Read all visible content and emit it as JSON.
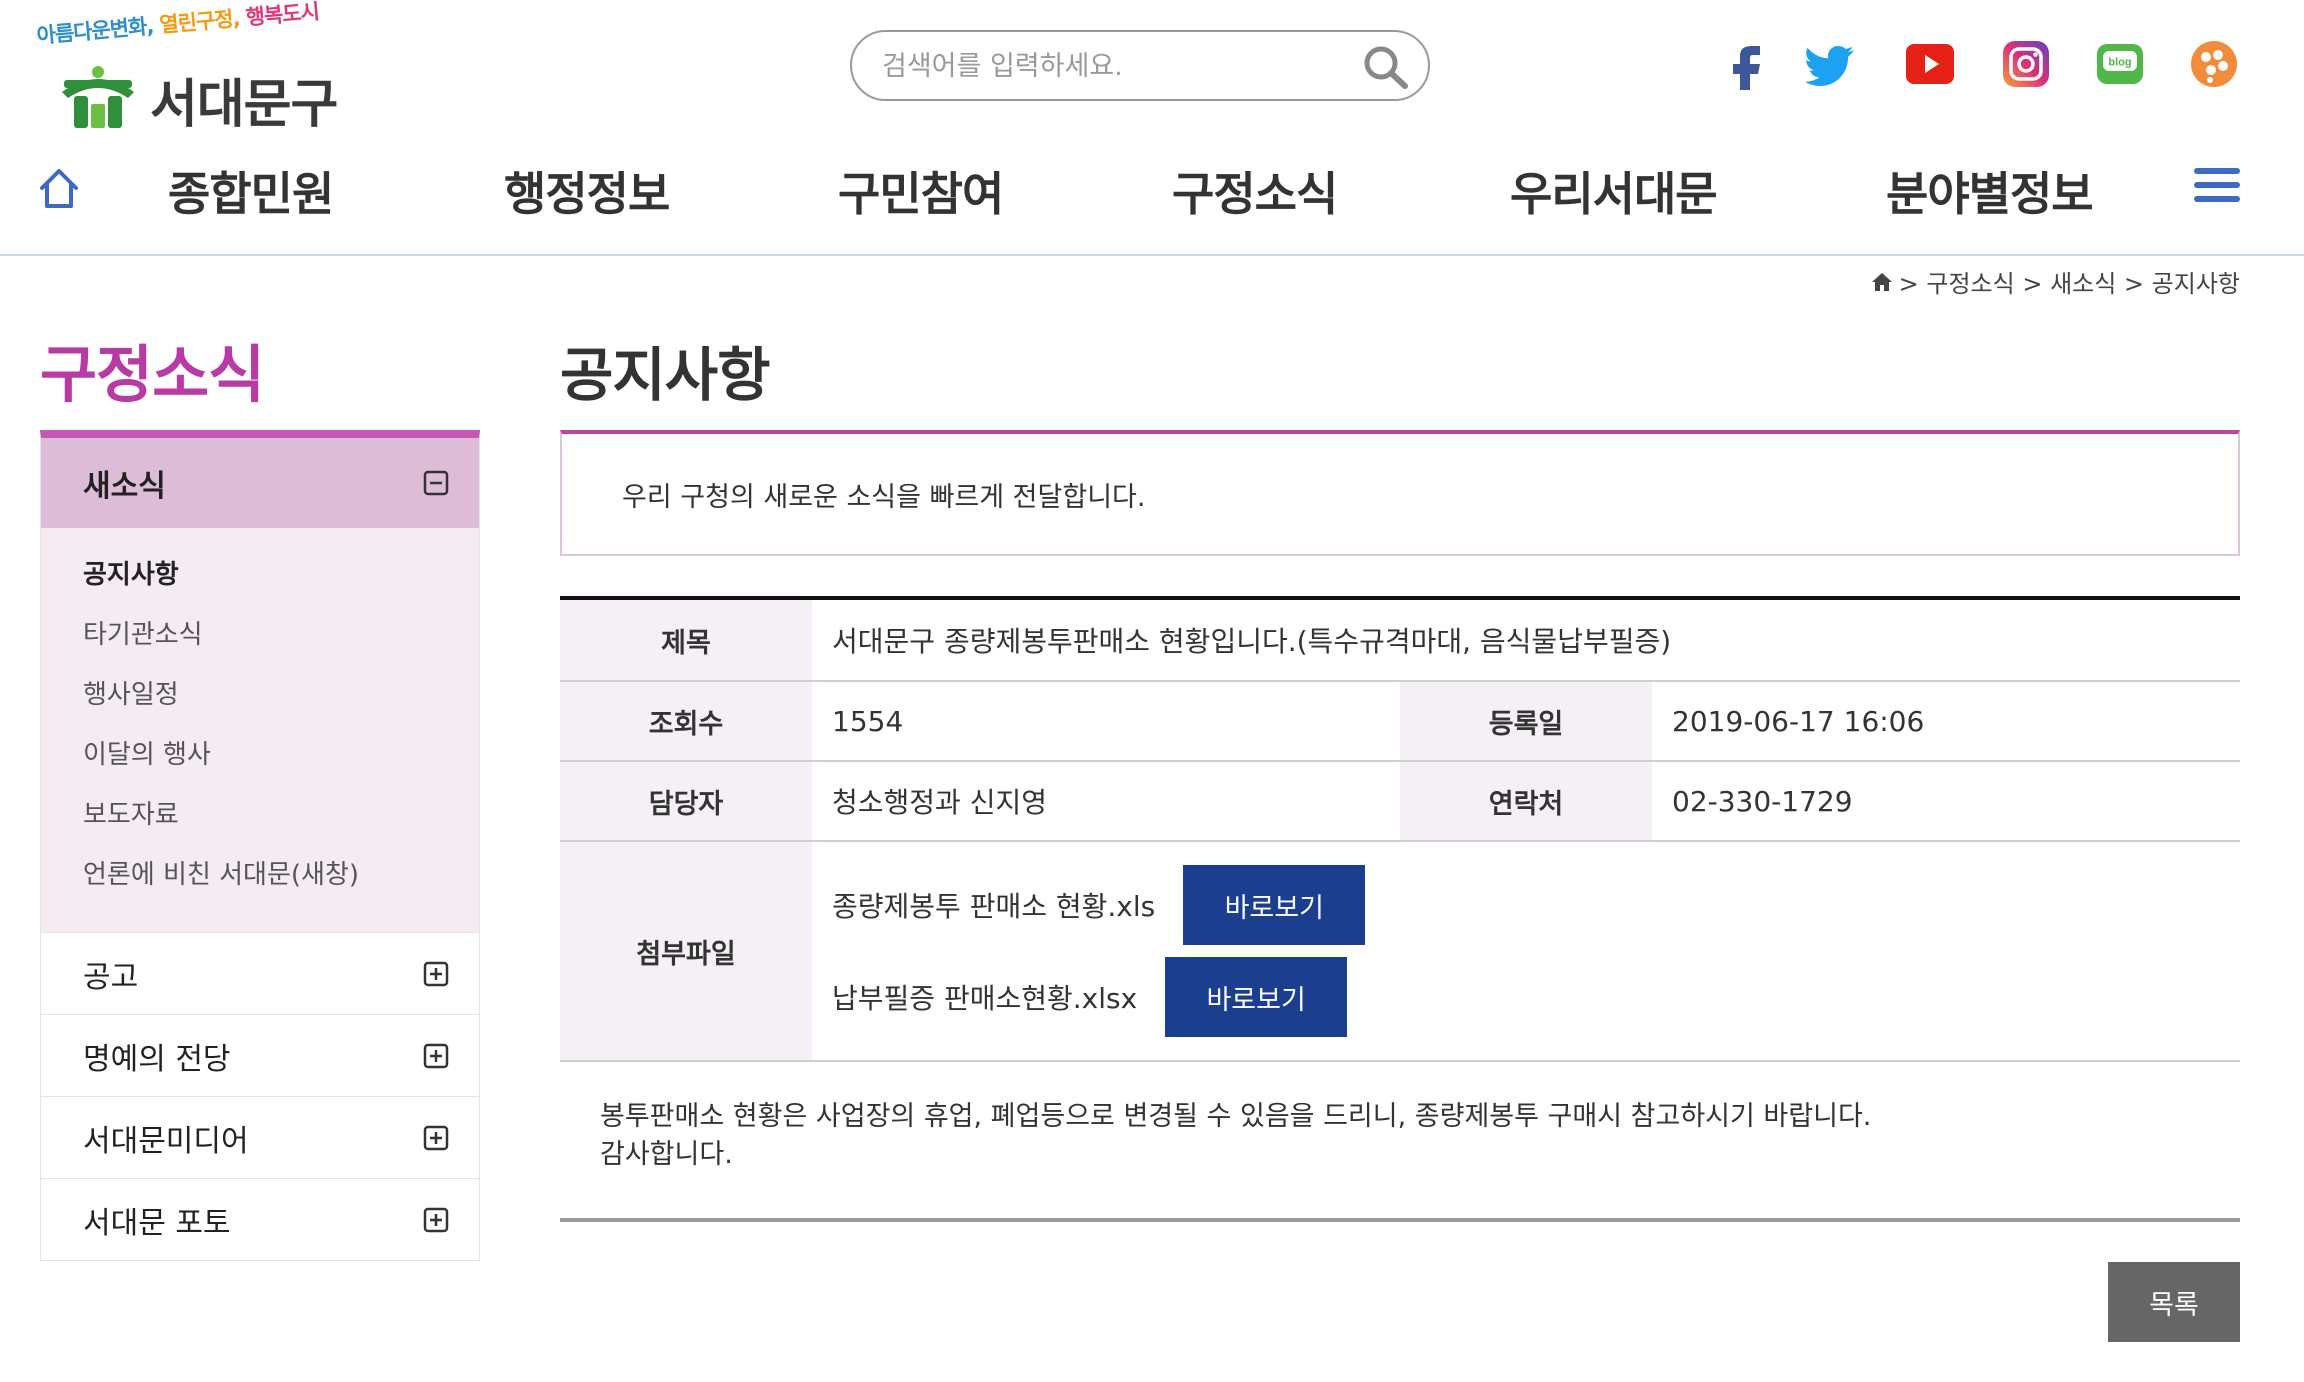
{
  "header": {
    "logo": {
      "slogan_1": "아름다운변화,",
      "slogan_2": "열린구정,",
      "slogan_3": "행복도시",
      "name": "서대문구"
    },
    "search": {
      "placeholder": "검색어를 입력하세요.",
      "value": ""
    },
    "sns": [
      {
        "name": "facebook",
        "icon": "facebook-icon",
        "color": "#3b5998"
      },
      {
        "name": "twitter",
        "icon": "twitter-icon",
        "color": "#1da1f2"
      },
      {
        "name": "youtube",
        "icon": "youtube-icon",
        "color": "#e62117"
      },
      {
        "name": "instagram",
        "icon": "instagram-icon",
        "color": "#c1358f"
      },
      {
        "name": "blog",
        "icon": "blog-icon",
        "label": "blog",
        "color": "#4fb848"
      },
      {
        "name": "kakao-story",
        "icon": "kakao-story-icon",
        "color": "#f08c3b"
      }
    ]
  },
  "gnb": {
    "items": [
      "종합민원",
      "행정정보",
      "구민참여",
      "구정소식",
      "우리서대문",
      "분야별정보"
    ],
    "home_icon": "home-icon",
    "menu_icon": "hamburger-menu-icon"
  },
  "breadcrumb": {
    "home_icon": "home-icon",
    "text": "> 구정소식 > 새소식 > 공지사항"
  },
  "sidebar": {
    "title": "구정소식",
    "open_group": {
      "label": "새소식",
      "items": [
        "공지사항",
        "타기관소식",
        "행사일정",
        "이달의 행사",
        "보도자료",
        "언론에 비친 서대문(새창)"
      ]
    },
    "groups": [
      "공고",
      "명예의 전당",
      "서대문미디어",
      "서대문 포토"
    ]
  },
  "main": {
    "title": "공지사항",
    "intro": "우리 구청의 새로운 소식을 빠르게 전달합니다.",
    "board": {
      "title_label": "제목",
      "title_value": "서대문구 종량제봉투판매소 현황입니다.(특수규격마대, 음식물납부필증)",
      "views_label": "조회수",
      "views_value": "1554",
      "date_label": "등록일",
      "date_value": "2019-06-17 16:06",
      "manager_label": "담당자",
      "manager_value": "청소행정과 신지영",
      "contact_label": "연락처",
      "contact_value": "02-330-1729",
      "files_label": "첨부파일",
      "files": [
        {
          "name": "종량제봉투 판매소 현황.xls",
          "button": "바로보기"
        },
        {
          "name": "납부필증 판매소현황.xlsx",
          "button": "바로보기"
        }
      ]
    },
    "content_line_1": "봉투판매소 현황은 사업장의 휴업, 폐업등으로 변경될 수 있음을 드리니, 종량제봉투 구매시 참고하시기 바랍니다.",
    "content_line_2": "감사합니다.",
    "list_button": "목록"
  },
  "colors": {
    "accent_magenta": "#b83ba4",
    "sidebar_active_bg": "#ddbcd8",
    "button_navy": "#1c3e8e",
    "gnb_icon_blue": "#3e6bc2"
  }
}
